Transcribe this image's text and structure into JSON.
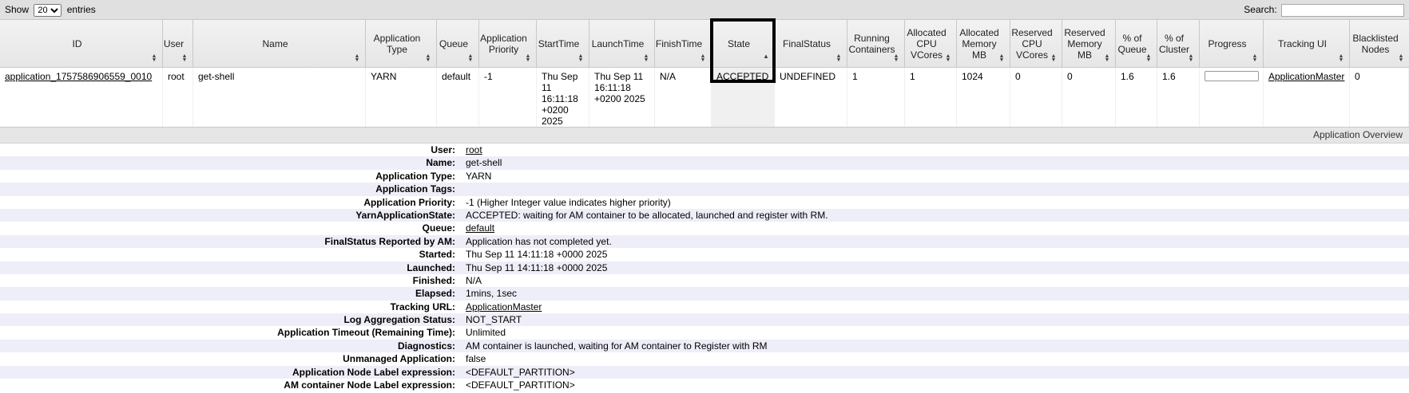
{
  "toolbar": {
    "show_label": "Show",
    "entries_value": "20",
    "entries_label": "entries",
    "search_label": "Search:",
    "search_value": ""
  },
  "table": {
    "columns": [
      {
        "label": "ID"
      },
      {
        "label": "User"
      },
      {
        "label": "Name"
      },
      {
        "label": "Application Type"
      },
      {
        "label": "Queue"
      },
      {
        "label": "Application Priority"
      },
      {
        "label": "StartTime"
      },
      {
        "label": "LaunchTime"
      },
      {
        "label": "FinishTime"
      },
      {
        "label": "State"
      },
      {
        "label": "FinalStatus"
      },
      {
        "label": "Running Containers"
      },
      {
        "label": "Allocated CPU VCores"
      },
      {
        "label": "Allocated Memory MB"
      },
      {
        "label": "Reserved CPU VCores"
      },
      {
        "label": "Reserved Memory MB"
      },
      {
        "label": "% of Queue"
      },
      {
        "label": "% of Cluster"
      },
      {
        "label": "Progress"
      },
      {
        "label": "Tracking UI"
      },
      {
        "label": "Blacklisted Nodes"
      }
    ],
    "sorted_column": "State",
    "row": {
      "id": "application_1757586906559_0010",
      "user": "root",
      "name": "get-shell",
      "app_type": "YARN",
      "queue": "default",
      "priority": "-1",
      "start_time": "Thu Sep 11 16:11:18 +0200 2025",
      "launch_time": "Thu Sep 11 16:11:18 +0200 2025",
      "finish_time": "N/A",
      "state": "ACCEPTED",
      "final_status": "UNDEFINED",
      "running_containers": "1",
      "alloc_vcores": "1",
      "alloc_mem": "1024",
      "res_vcores": "0",
      "res_mem": "0",
      "pct_queue": "1.6",
      "pct_cluster": "1.6",
      "progress": 0,
      "tracking_ui": "ApplicationMaster",
      "blacklisted": "0"
    }
  },
  "overview": {
    "title": "Application Overview",
    "rows": [
      {
        "label": "User:",
        "value": "root",
        "link": true
      },
      {
        "label": "Name:",
        "value": "get-shell"
      },
      {
        "label": "Application Type:",
        "value": "YARN"
      },
      {
        "label": "Application Tags:",
        "value": ""
      },
      {
        "label": "Application Priority:",
        "value": "-1 (Higher Integer value indicates higher priority)"
      },
      {
        "label": "YarnApplicationState:",
        "value": "ACCEPTED: waiting for AM container to be allocated, launched and register with RM."
      },
      {
        "label": "Queue:",
        "value": "default",
        "link": true
      },
      {
        "label": "FinalStatus Reported by AM:",
        "value": "Application has not completed yet."
      },
      {
        "label": "Started:",
        "value": "Thu Sep 11 14:11:18 +0000 2025"
      },
      {
        "label": "Launched:",
        "value": "Thu Sep 11 14:11:18 +0000 2025"
      },
      {
        "label": "Finished:",
        "value": "N/A"
      },
      {
        "label": "Elapsed:",
        "value": "1mins, 1sec"
      },
      {
        "label": "Tracking URL:",
        "value": "ApplicationMaster",
        "link": true
      },
      {
        "label": "Log Aggregation Status:",
        "value": "NOT_START"
      },
      {
        "label": "Application Timeout (Remaining Time):",
        "value": "Unlimited"
      },
      {
        "label": "Diagnostics:",
        "value": "AM container is launched, waiting for AM container to Register with RM"
      },
      {
        "label": "Unmanaged Application:",
        "value": "false"
      },
      {
        "label": "Application Node Label expression:",
        "value": "<DEFAULT_PARTITION>"
      },
      {
        "label": "AM container Node Label expression:",
        "value": "<DEFAULT_PARTITION>"
      }
    ]
  }
}
